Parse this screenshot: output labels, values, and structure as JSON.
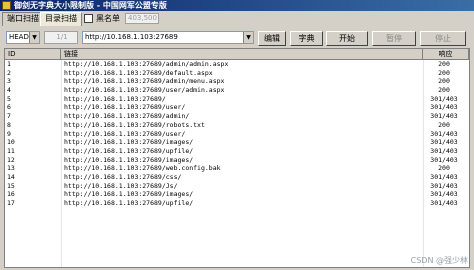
{
  "window": {
    "title": "御剑无字典大小限制版 - 中国网军公盟专版"
  },
  "tabs": [
    {
      "label": "端口扫描"
    },
    {
      "label": "目录扫描"
    }
  ],
  "blacklist": {
    "label": "黑名单",
    "value": "403,500"
  },
  "toolbar": {
    "method": "HEAD",
    "thread_spin": "1/1",
    "target_url": "http://10.168.1.103:27689",
    "edit_label": "编辑",
    "dict_label": "字典",
    "start_label": "开始",
    "pause_label": "暂停",
    "stop_label": "停止"
  },
  "table": {
    "columns": [
      "ID",
      "链接",
      "响应"
    ],
    "rows": [
      {
        "id": "1",
        "url": "http://10.168.1.103:27689/admin/admin.aspx",
        "status": "200"
      },
      {
        "id": "2",
        "url": "http://10.168.1.103:27689/default.aspx",
        "status": "200"
      },
      {
        "id": "3",
        "url": "http://10.168.1.103:27689/admin/menu.aspx",
        "status": "200"
      },
      {
        "id": "4",
        "url": "http://10.168.1.103:27689/user/admin.aspx",
        "status": "200"
      },
      {
        "id": "5",
        "url": "http://10.168.1.103:27689/",
        "status": "301/403"
      },
      {
        "id": "6",
        "url": "http://10.168.1.103:27689/user/",
        "status": "301/403"
      },
      {
        "id": "7",
        "url": "http://10.168.1.103:27689/admin/",
        "status": "301/403"
      },
      {
        "id": "8",
        "url": "http://10.168.1.103:27689/robots.txt",
        "status": "200"
      },
      {
        "id": "9",
        "url": "http://10.168.1.103:27689/user/",
        "status": "301/403"
      },
      {
        "id": "10",
        "url": "http://10.168.1.103:27689/images/",
        "status": "301/403"
      },
      {
        "id": "11",
        "url": "http://10.168.1.103:27689/upfile/",
        "status": "301/403"
      },
      {
        "id": "12",
        "url": "http://10.168.1.103:27689/images/",
        "status": "301/403"
      },
      {
        "id": "13",
        "url": "http://10.168.1.103:27689/web.config.bak",
        "status": "200"
      },
      {
        "id": "14",
        "url": "http://10.168.1.103:27689/css/",
        "status": "301/403"
      },
      {
        "id": "15",
        "url": "http://10.168.1.103:27689/Js/",
        "status": "301/403"
      },
      {
        "id": "16",
        "url": "http://10.168.1.103:27689/images/",
        "status": "301/403"
      },
      {
        "id": "17",
        "url": "http://10.168.1.103:27689/upfile/",
        "status": "301/403"
      }
    ]
  },
  "watermark": "CSDN @强少林",
  "colors": {
    "titlebar_start": "#0a246a",
    "titlebar_end": "#3a6ea5",
    "face": "#d4d0c8"
  }
}
